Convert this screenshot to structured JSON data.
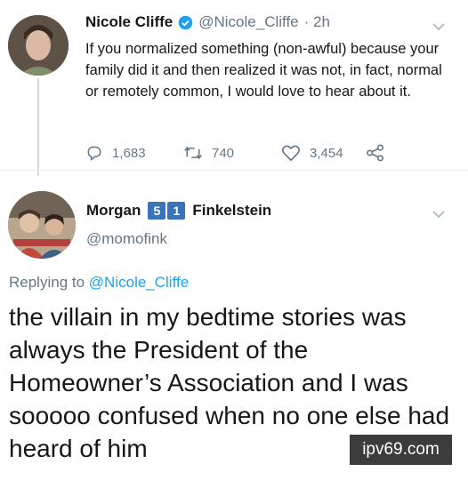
{
  "tweet1": {
    "display_name": "Nicole Cliffe",
    "handle": "@Nicole_Cliffe",
    "time": "· 2h",
    "text": "If you normalized something (non-awful) because your family did it and then realized it was not, in fact, normal or remotely common, I would love to hear about it.",
    "actions": {
      "replies": "1,683",
      "retweets": "740",
      "likes": "3,454"
    }
  },
  "tweet2": {
    "name_first": "Morgan",
    "name_badges": [
      "5",
      "1"
    ],
    "name_last": "Finkelstein",
    "handle": "@momofink",
    "replying_prefix": "Replying to",
    "replying_handle": "@Nicole_Cliffe",
    "text": "the villain in my bedtime stories was always the President of the Homeowner’s Association and I was sooooo confused when no one else had heard of him"
  },
  "watermark": "ipv69.com",
  "colors": {
    "link": "#1da1f2",
    "secondary": "#657786",
    "badge": "#3b73b9",
    "verified": "#1da1f2"
  }
}
